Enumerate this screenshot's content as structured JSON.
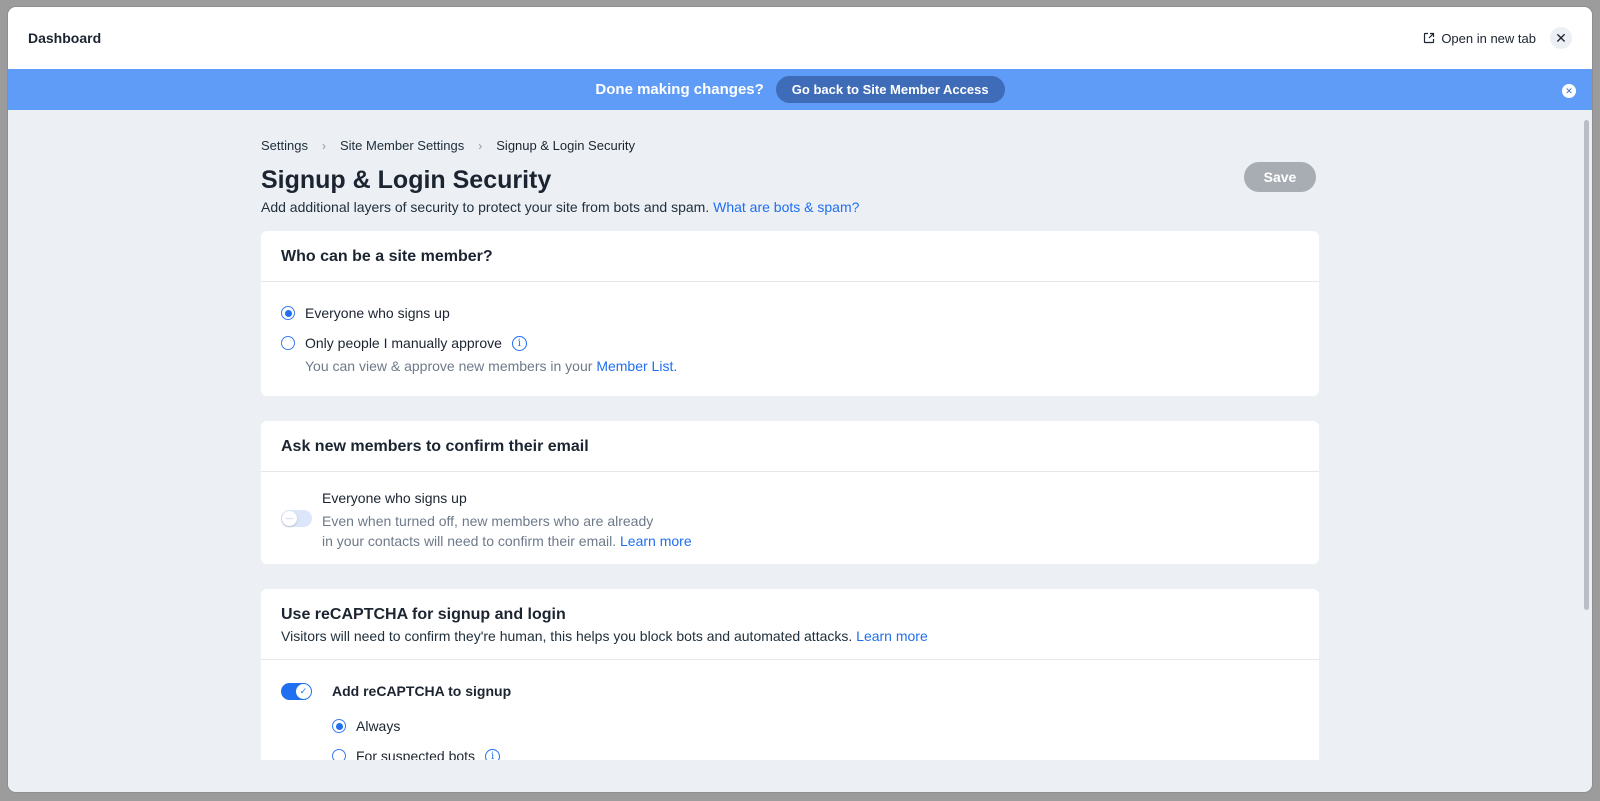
{
  "window": {
    "title": "Dashboard",
    "open_in_new_tab": "Open in new tab",
    "close_symbol": "✕"
  },
  "banner": {
    "message": "Done making changes?",
    "button": "Go back to Site Member Access",
    "close_symbol": "✕"
  },
  "breadcrumb": {
    "items": [
      "Settings",
      "Site Member Settings",
      "Signup & Login Security"
    ],
    "separator": "›"
  },
  "page": {
    "title": "Signup & Login Security",
    "subtitle": "Add additional layers of security to protect your site from bots and spam.",
    "subtitle_link": "What are bots & spam?",
    "save_label": "Save"
  },
  "who_can_join": {
    "heading": "Who can be a site member?",
    "option_everyone": "Everyone who signs up",
    "option_manual": "Only people I manually approve",
    "manual_hint": "You can view & approve new members in your",
    "manual_hint_link": "Member List.",
    "selected": "everyone"
  },
  "confirm_email": {
    "heading": "Ask new members to confirm their email",
    "toggle_label": "Everyone who signs up",
    "toggle_on": false,
    "hint_line1": "Even when turned off, new members who are already",
    "hint_line2": "in your contacts will need to confirm their email.",
    "hint_link": "Learn more"
  },
  "recaptcha": {
    "heading": "Use reCAPTCHA for signup and login",
    "description": "Visitors will need to confirm they're human, this helps you block bots and automated attacks.",
    "description_link": "Learn more",
    "signup_toggle_label": "Add reCAPTCHA to signup",
    "signup_toggle_on": true,
    "option_always": "Always",
    "option_suspected": "For suspected bots",
    "selected": "always"
  },
  "colors": {
    "accent": "#1f6ff0",
    "banner": "#5f9cf8",
    "banner_button": "#3e6cb8",
    "page_bg": "#eceff4"
  }
}
